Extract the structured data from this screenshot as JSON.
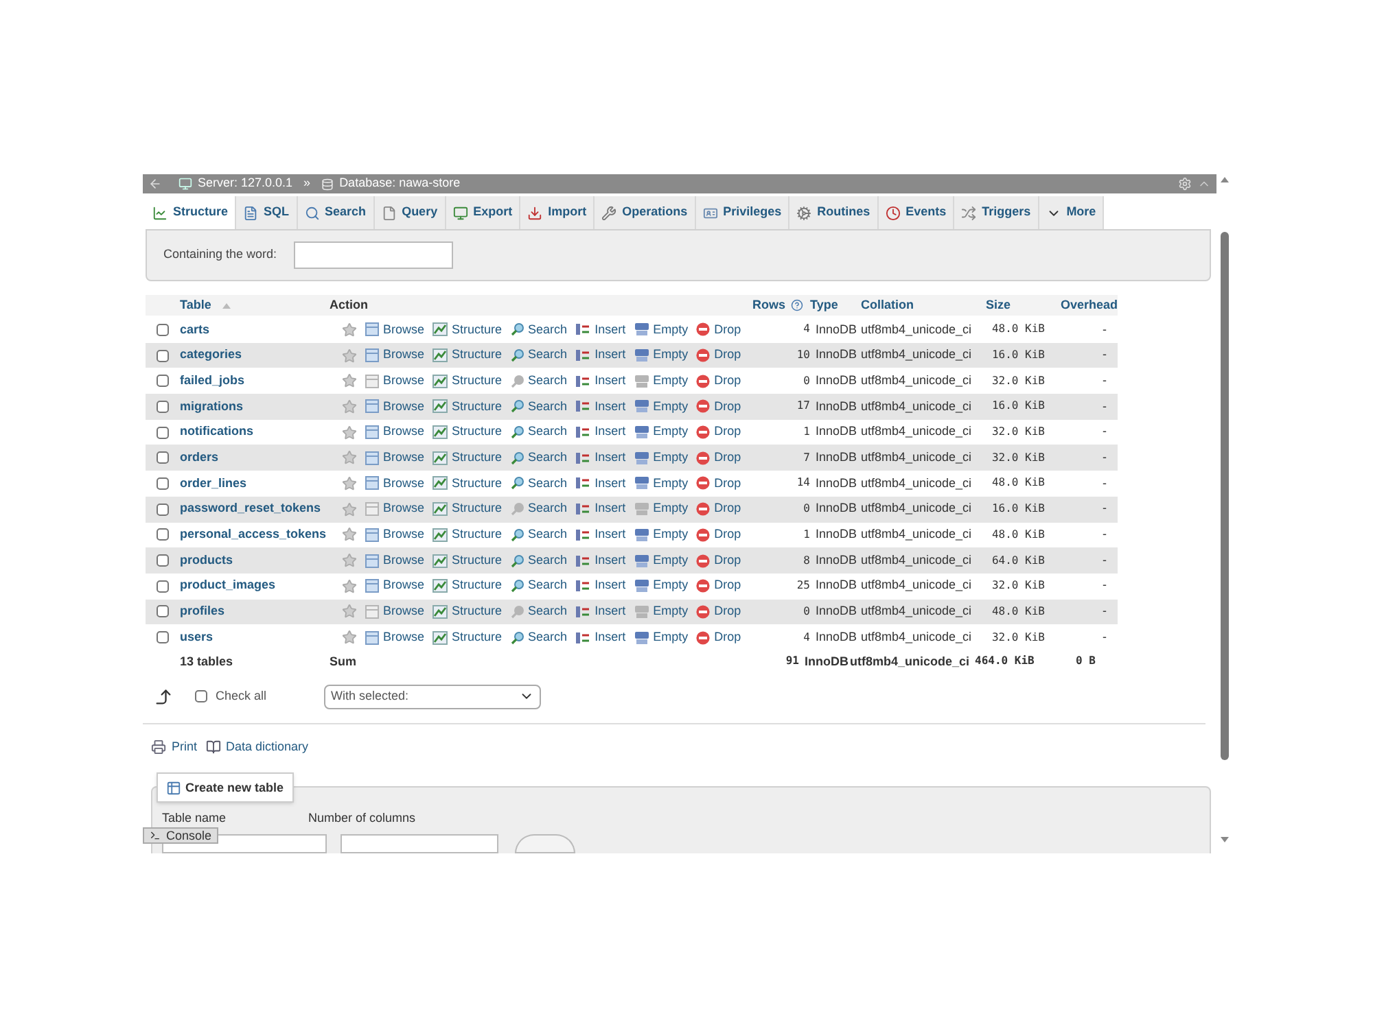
{
  "breadcrumb": {
    "server": "Server: 127.0.0.1",
    "separator": "»",
    "database": "Database: nawa-store"
  },
  "tabs": [
    {
      "label": "Structure",
      "selected": true
    },
    {
      "label": "SQL",
      "selected": false
    },
    {
      "label": "Search",
      "selected": false
    },
    {
      "label": "Query",
      "selected": false
    },
    {
      "label": "Export",
      "selected": false
    },
    {
      "label": "Import",
      "selected": false
    },
    {
      "label": "Operations",
      "selected": false
    },
    {
      "label": "Privileges",
      "selected": false
    },
    {
      "label": "Routines",
      "selected": false
    },
    {
      "label": "Events",
      "selected": false
    },
    {
      "label": "Triggers",
      "selected": false
    },
    {
      "label": "More",
      "selected": false
    }
  ],
  "filter": {
    "label": "Containing the word:"
  },
  "table": {
    "columns": [
      "Table",
      "Action",
      "Rows",
      "Type",
      "Collation",
      "Size",
      "Overhead"
    ],
    "rows": [
      {
        "name": "carts",
        "actions": [
          "Browse",
          "Structure",
          "Search",
          "Insert",
          "Empty",
          "Drop"
        ],
        "rows": "4",
        "type": "InnoDB",
        "collation": "utf8mb4_unicode_ci",
        "size": "48.0 KiB",
        "overhead": "-",
        "checked": false,
        "empty": false
      },
      {
        "name": "categories",
        "actions": [
          "Browse",
          "Structure",
          "Search",
          "Insert",
          "Empty",
          "Drop"
        ],
        "rows": "10",
        "type": "InnoDB",
        "collation": "utf8mb4_unicode_ci",
        "size": "16.0 KiB",
        "overhead": "-",
        "checked": false,
        "empty": false
      },
      {
        "name": "failed_jobs",
        "actions": [
          "Browse",
          "Structure",
          "Search",
          "Insert",
          "Empty",
          "Drop"
        ],
        "rows": "0",
        "type": "InnoDB",
        "collation": "utf8mb4_unicode_ci",
        "size": "32.0 KiB",
        "overhead": "-",
        "checked": false,
        "empty": true
      },
      {
        "name": "migrations",
        "actions": [
          "Browse",
          "Structure",
          "Search",
          "Insert",
          "Empty",
          "Drop"
        ],
        "rows": "17",
        "type": "InnoDB",
        "collation": "utf8mb4_unicode_ci",
        "size": "16.0 KiB",
        "overhead": "-",
        "checked": false,
        "empty": false
      },
      {
        "name": "notifications",
        "actions": [
          "Browse",
          "Structure",
          "Search",
          "Insert",
          "Empty",
          "Drop"
        ],
        "rows": "1",
        "type": "InnoDB",
        "collation": "utf8mb4_unicode_ci",
        "size": "32.0 KiB",
        "overhead": "-",
        "checked": false,
        "empty": false
      },
      {
        "name": "orders",
        "actions": [
          "Browse",
          "Structure",
          "Search",
          "Insert",
          "Empty",
          "Drop"
        ],
        "rows": "7",
        "type": "InnoDB",
        "collation": "utf8mb4_unicode_ci",
        "size": "32.0 KiB",
        "overhead": "-",
        "checked": false,
        "empty": false
      },
      {
        "name": "order_lines",
        "actions": [
          "Browse",
          "Structure",
          "Search",
          "Insert",
          "Empty",
          "Drop"
        ],
        "rows": "14",
        "type": "InnoDB",
        "collation": "utf8mb4_unicode_ci",
        "size": "48.0 KiB",
        "overhead": "-",
        "checked": false,
        "empty": false
      },
      {
        "name": "password_reset_tokens",
        "actions": [
          "Browse",
          "Structure",
          "Search",
          "Insert",
          "Empty",
          "Drop"
        ],
        "rows": "0",
        "type": "InnoDB",
        "collation": "utf8mb4_unicode_ci",
        "size": "16.0 KiB",
        "overhead": "-",
        "checked": false,
        "empty": true
      },
      {
        "name": "personal_access_tokens",
        "actions": [
          "Browse",
          "Structure",
          "Search",
          "Insert",
          "Empty",
          "Drop"
        ],
        "rows": "1",
        "type": "InnoDB",
        "collation": "utf8mb4_unicode_ci",
        "size": "48.0 KiB",
        "overhead": "-",
        "checked": false,
        "empty": false
      },
      {
        "name": "products",
        "actions": [
          "Browse",
          "Structure",
          "Search",
          "Insert",
          "Empty",
          "Drop"
        ],
        "rows": "8",
        "type": "InnoDB",
        "collation": "utf8mb4_unicode_ci",
        "size": "64.0 KiB",
        "overhead": "-",
        "checked": false,
        "empty": false
      },
      {
        "name": "product_images",
        "actions": [
          "Browse",
          "Structure",
          "Search",
          "Insert",
          "Empty",
          "Drop"
        ],
        "rows": "25",
        "type": "InnoDB",
        "collation": "utf8mb4_unicode_ci",
        "size": "32.0 KiB",
        "overhead": "-",
        "checked": false,
        "empty": false
      },
      {
        "name": "profiles",
        "actions": [
          "Browse",
          "Structure",
          "Search",
          "Insert",
          "Empty",
          "Drop"
        ],
        "rows": "0",
        "type": "InnoDB",
        "collation": "utf8mb4_unicode_ci",
        "size": "48.0 KiB",
        "overhead": "-",
        "checked": false,
        "empty": true
      },
      {
        "name": "users",
        "actions": [
          "Browse",
          "Structure",
          "Search",
          "Insert",
          "Empty",
          "Drop"
        ],
        "rows": "4",
        "type": "InnoDB",
        "collation": "utf8mb4_unicode_ci",
        "size": "32.0 KiB",
        "overhead": "-",
        "checked": false,
        "empty": false
      }
    ],
    "footer": {
      "count": "13 tables",
      "label": "Sum",
      "rows": "91",
      "type": "InnoDB",
      "collation": "utf8mb4_unicode_ci",
      "size": "464.0 KiB",
      "overhead": "0 B"
    }
  },
  "check_all": {
    "label": "Check all",
    "checked": false
  },
  "with_selected": {
    "value": "With selected:"
  },
  "links": [
    "Print",
    "Data dictionary"
  ],
  "create_table": {
    "legend": "Create new table",
    "table_name_label": "Table name",
    "columns_label": "Number of columns"
  },
  "console": {
    "label": "Console"
  }
}
